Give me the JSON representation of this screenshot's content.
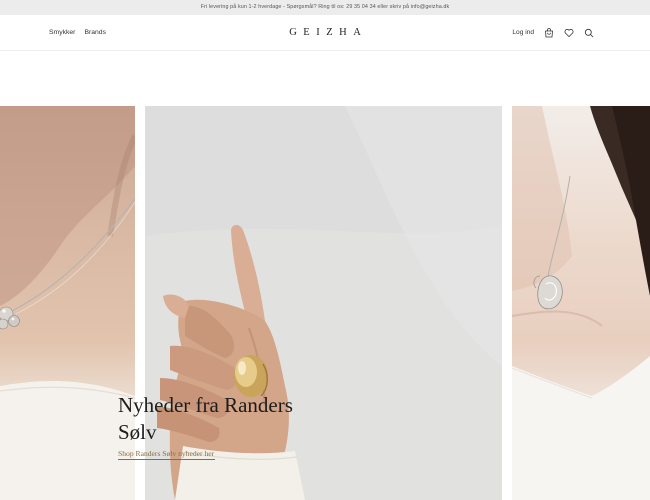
{
  "announcement": {
    "text": "Fri levering på kun 1-2 hverdage - Spørgsmål? Ring til os: 29 35 04 34 eller skriv på info@geizha.dk"
  },
  "header": {
    "nav": [
      {
        "label": "Smykker"
      },
      {
        "label": "Brands"
      }
    ],
    "logo": "GEIZHA",
    "login_label": "Log ind",
    "icons": [
      "cart-icon",
      "heart-icon",
      "search-icon"
    ]
  },
  "hero": {
    "title_line1": "Nyheder fra Randers",
    "title_line2": "Sølv",
    "cta_label": "Shop Randers Sølv nyheder her"
  },
  "colors": {
    "announcement_bg": "#ececec",
    "cta_gold": "#8a6d3f",
    "ring_gold": "#c9a45a"
  }
}
